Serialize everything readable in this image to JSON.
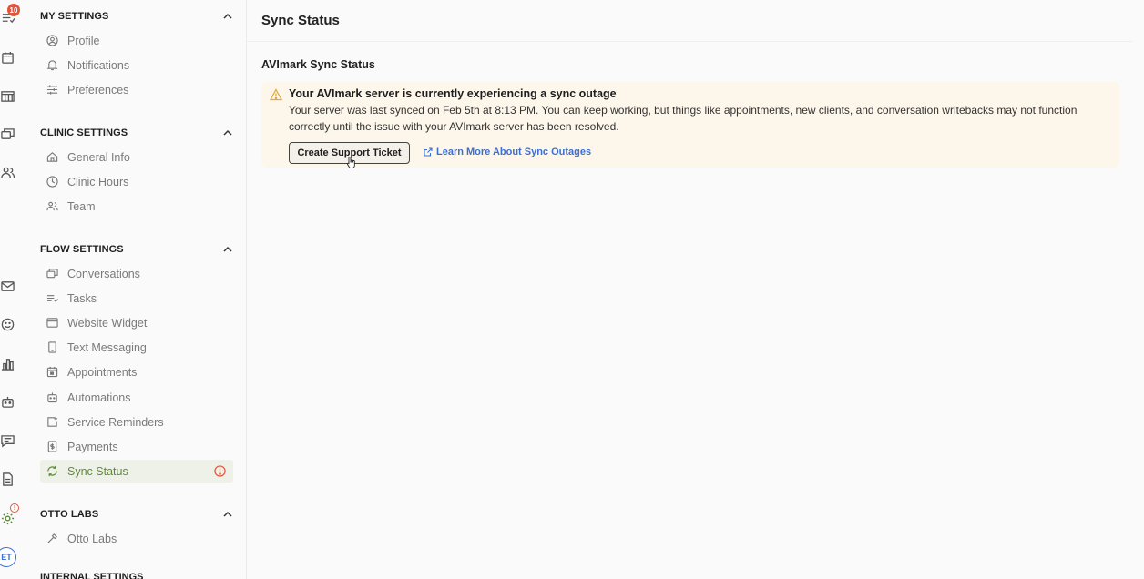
{
  "rail": {
    "task_badge": "10",
    "avatar_initials": "ET",
    "settings_alert": "!"
  },
  "sidebar": {
    "sections": [
      {
        "title": "MY SETTINGS",
        "items": [
          "Profile",
          "Notifications",
          "Preferences"
        ]
      },
      {
        "title": "CLINIC SETTINGS",
        "items": [
          "General Info",
          "Clinic Hours",
          "Team"
        ]
      },
      {
        "title": "FLOW SETTINGS",
        "items": [
          "Conversations",
          "Tasks",
          "Website Widget",
          "Text Messaging",
          "Appointments",
          "Automations",
          "Service Reminders",
          "Payments",
          "Sync Status"
        ]
      },
      {
        "title": "OTTO LABS",
        "items": [
          "Otto Labs"
        ]
      }
    ],
    "cut_off_section": "INTERNAL SETTINGS",
    "active_item": "Sync Status"
  },
  "main": {
    "page_title": "Sync Status",
    "section_title": "AVImark Sync Status",
    "alert": {
      "title": "Your AVImark server is currently experiencing a sync outage",
      "body": "Your server was last synced on Feb 5th at 8:13 PM. You can keep working, but things like appointments, new clients, and conversation writebacks may not function correctly until the issue with your AVImark server has been resolved.",
      "button_label": "Create Support Ticket",
      "link_label": "Learn More About Sync Outages"
    }
  },
  "colors": {
    "accent_green": "#5f8a3a",
    "alert_bg": "#fdf6ea",
    "warning": "#e3a93a",
    "error": "#e0563b",
    "link": "#3b6fd4"
  }
}
